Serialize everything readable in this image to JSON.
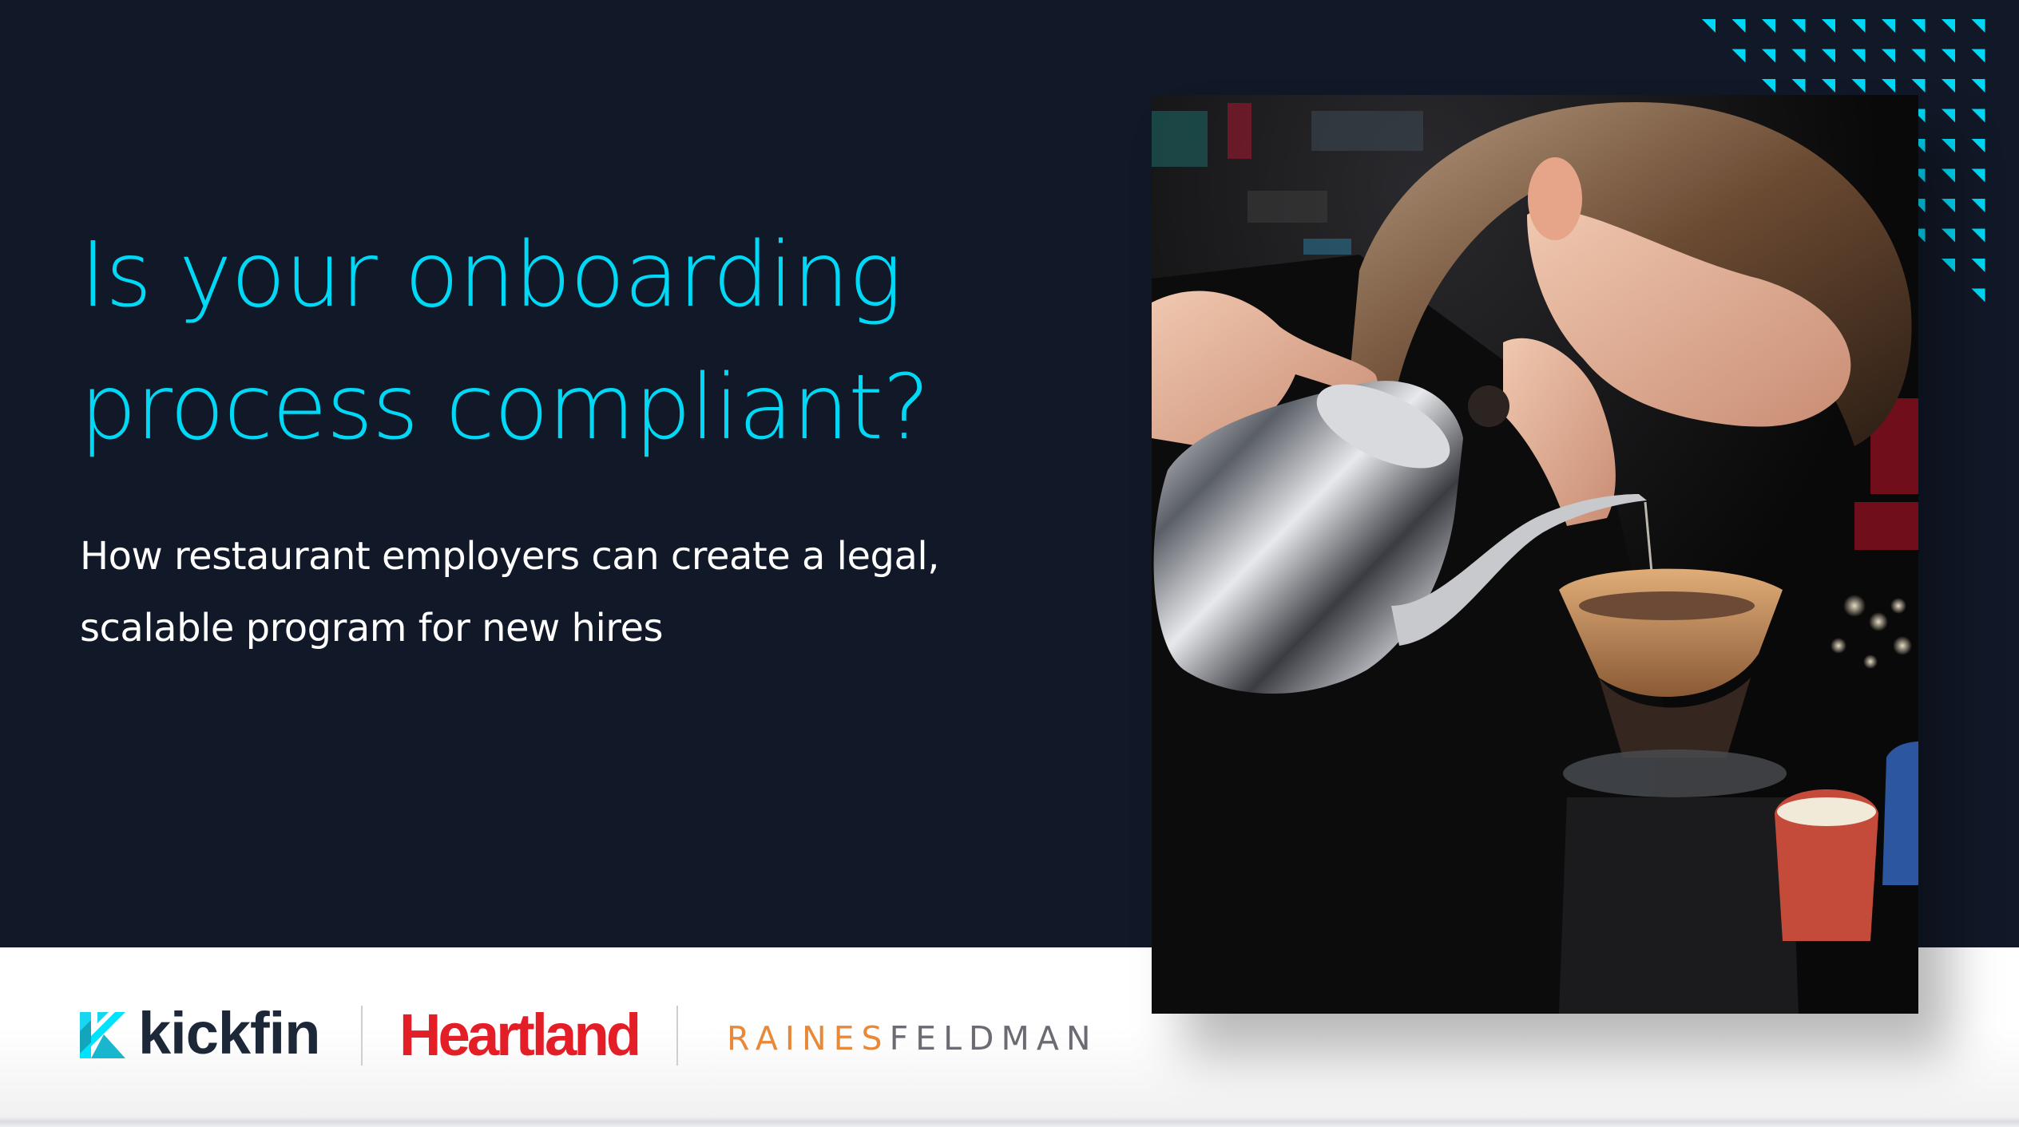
{
  "hero": {
    "title_lines": [
      "Is your onboarding",
      "process compliant?"
    ],
    "subtitle_lines": [
      "How restaurant employers can create a legal,",
      "scalable program for new hires"
    ],
    "photo_description": "Barista pouring water from a gooseneck kettle into a pour-over coffee dripper"
  },
  "decoration": {
    "pattern": "triangle-staircase-icon",
    "rows": 10,
    "cols": 10
  },
  "logos": {
    "kickfin": "kickfin",
    "heartland": "Heartland",
    "raines_part1": "RAINES",
    "raines_part2": "FELDMAN"
  },
  "colors": {
    "background": "#111827",
    "accent_cyan": "#00d8f5",
    "heartland_red": "#e31e26",
    "raines_orange": "#e8893a",
    "feldman_gray": "#6b6b73",
    "kickfin_text": "#1c2838"
  }
}
